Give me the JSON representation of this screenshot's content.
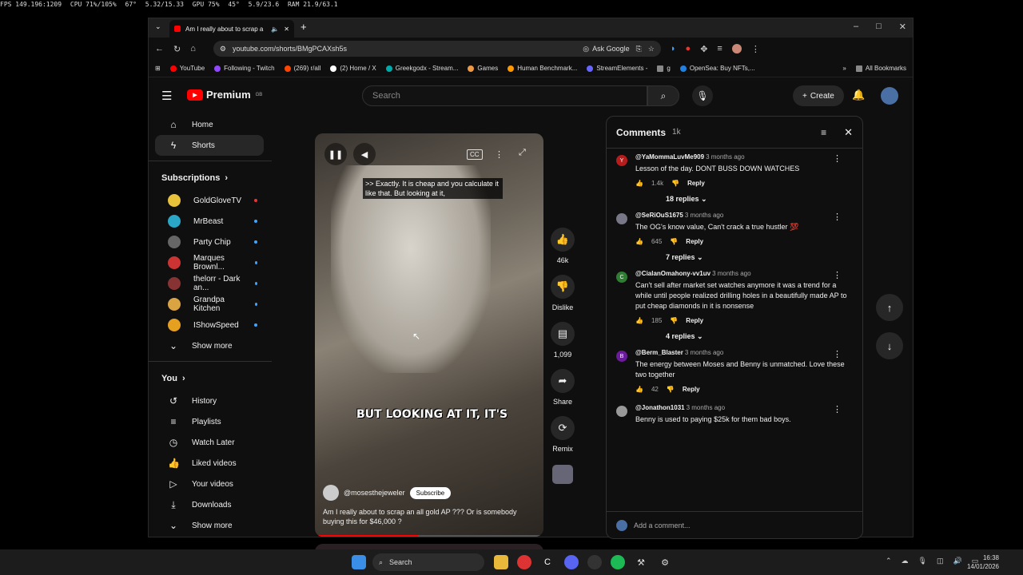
{
  "overlay": {
    "fps": "FPS 149.196:1209",
    "cpu": "CPU 71%/105%",
    "cpu_temp": "67°",
    "cpu_freq": "5.32/15.33",
    "gpu": "GPU 75%",
    "gpu_temp": "45°",
    "gpu_mem": "5.9/23.6",
    "ram": "RAM 21.9/63.1"
  },
  "browser": {
    "tab_title": "Am I really about to scrap a",
    "url": "youtube.com/shorts/BMgPCAXsh5s",
    "ask_google": "Ask Google",
    "bookmarks": [
      {
        "label": "YouTube",
        "color": "#ff0000"
      },
      {
        "label": "Following - Twitch",
        "color": "#9146ff"
      },
      {
        "label": "(269) r/all",
        "color": "#ff4500"
      },
      {
        "label": "(2) Home / X",
        "color": "#ffffff"
      },
      {
        "label": "Greekgodx - Stream...",
        "color": "#0aa"
      },
      {
        "label": "Games",
        "color": "#e94"
      },
      {
        "label": "Human Benchmark...",
        "color": "#f90"
      },
      {
        "label": "StreamElements -",
        "color": "#66f"
      },
      {
        "label": "g",
        "color": "#888"
      },
      {
        "label": "OpenSea: Buy NFTs,...",
        "color": "#2081e2"
      }
    ],
    "all_bookmarks": "All Bookmarks"
  },
  "yt": {
    "brand": "Premium",
    "region": "GB",
    "search_placeholder": "Search",
    "create": "Create",
    "nav": {
      "home": "Home",
      "shorts": "Shorts"
    },
    "subscriptions_heading": "Subscriptions",
    "subscriptions": [
      {
        "name": "GoldGloveTV",
        "color": "#e8c23a",
        "live": "red"
      },
      {
        "name": "MrBeast",
        "color": "#2aa6c7",
        "live": "dot"
      },
      {
        "name": "Party Chip",
        "color": "#666",
        "live": "dot"
      },
      {
        "name": "Marques Brownl...",
        "color": "#c33",
        "live": "dot"
      },
      {
        "name": "thelorr - Dark an...",
        "color": "#833",
        "live": "dot"
      },
      {
        "name": "Grandpa Kitchen",
        "color": "#d9a441",
        "live": "dot"
      },
      {
        "name": "IShowSpeed",
        "color": "#e6a020",
        "live": "dot"
      }
    ],
    "show_more": "Show more",
    "you_heading": "You",
    "you_items": [
      "History",
      "Playlists",
      "Watch Later",
      "Liked videos",
      "Your videos",
      "Downloads"
    ],
    "show_more2": "Show more"
  },
  "video": {
    "caption": ">> Exactly. It is cheap and you calculate it like that. But looking at it,",
    "burned_caption": "BUT LOOKING AT IT, IT'S",
    "channel": "@mosesthejeweler",
    "subscribe": "Subscribe",
    "title": "Am I really about to scrap an all gold AP ??? Or is somebody buying this for $46,000 ?",
    "cc": "CC",
    "progress": 0.45
  },
  "actions": {
    "likes": "46k",
    "dislike": "Dislike",
    "comments": "1,099",
    "share": "Share",
    "remix": "Remix"
  },
  "comments": {
    "title": "Comments",
    "count": "1k",
    "add_placeholder": "Add a comment...",
    "items": [
      {
        "user": "@YaMommaLuvMe909",
        "time": "3 months ago",
        "text": "Lesson of the day. DONT BUSS DOWN WATCHES",
        "likes": "1.4k",
        "reply": "Reply",
        "replies": "18 replies",
        "avatar": "Y",
        "color": "#b71c1c"
      },
      {
        "user": "@SeRiOuS1675",
        "time": "3 months ago",
        "text": "The OG's know value, Can't crack a true hustler 💯",
        "likes": "645",
        "reply": "Reply",
        "replies": "7 replies",
        "avatar": "",
        "color": "#778"
      },
      {
        "user": "@CialanOmahony-vv1uv",
        "time": "3 months ago",
        "text": "Can't sell after market set watches anymore it was a trend for a while until people realized drilling holes in a beautifully made AP to put cheap diamonds in it is nonsense",
        "likes": "185",
        "reply": "Reply",
        "replies": "4 replies",
        "avatar": "C",
        "color": "#2e7d32"
      },
      {
        "user": "@Berm_Blaster",
        "time": "3 months ago",
        "text": "The energy between Moses and Benny is unmatched. Love these two together",
        "likes": "42",
        "reply": "Reply",
        "replies": "",
        "avatar": "B",
        "color": "#6a1b9a"
      },
      {
        "user": "@Jonathon1031",
        "time": "3 months ago",
        "text": "Benny is used to paying $25k for them bad boys.",
        "likes": "",
        "reply": "",
        "replies": "",
        "avatar": "",
        "color": "#999"
      }
    ]
  },
  "taskbar": {
    "search": "Search",
    "time": "16:38",
    "date": "14/01/2026"
  }
}
